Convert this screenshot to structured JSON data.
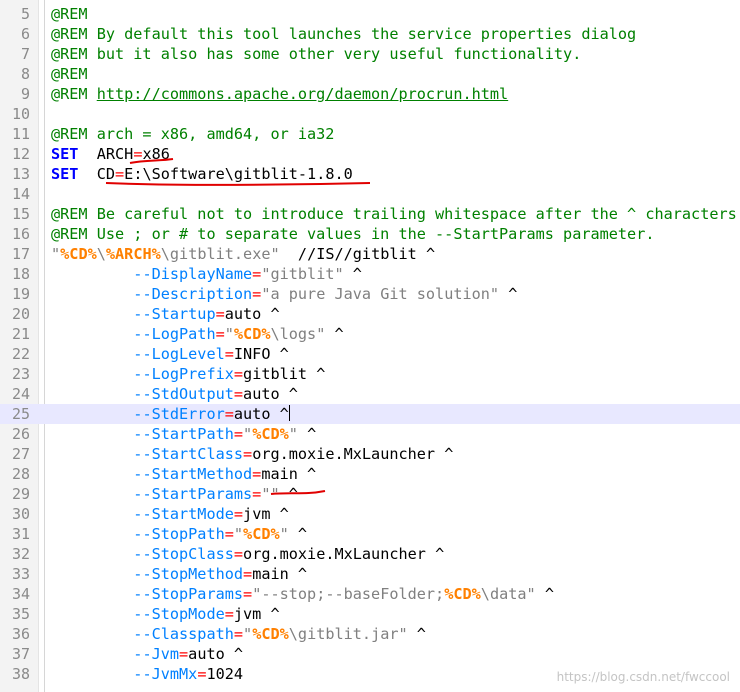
{
  "editor": {
    "lines": [
      {
        "n": "5",
        "segs": [
          [
            "cm",
            "@REM"
          ]
        ]
      },
      {
        "n": "6",
        "segs": [
          [
            "cm",
            "@REM By default this tool launches the service properties dialog"
          ]
        ]
      },
      {
        "n": "7",
        "segs": [
          [
            "cm",
            "@REM but it also has some other very useful functionality."
          ]
        ]
      },
      {
        "n": "8",
        "segs": [
          [
            "cm",
            "@REM"
          ]
        ]
      },
      {
        "n": "9",
        "segs": [
          [
            "cm",
            "@REM "
          ],
          [
            "cm url",
            "http://commons.apache.org/daemon/procrun.html"
          ]
        ]
      },
      {
        "n": "10",
        "segs": []
      },
      {
        "n": "11",
        "segs": [
          [
            "cm",
            "@REM arch = x86, amd64, or ia32"
          ]
        ]
      },
      {
        "n": "12",
        "segs": [
          [
            "kw",
            "SET"
          ],
          [
            "",
            "  ARCH"
          ],
          [
            "op",
            "="
          ],
          [
            "",
            "x86"
          ]
        ]
      },
      {
        "n": "13",
        "segs": [
          [
            "kw",
            "SET"
          ],
          [
            "",
            "  CD"
          ],
          [
            "op",
            "="
          ],
          [
            "",
            "E:\\Software\\gitblit-1.8.0"
          ]
        ]
      },
      {
        "n": "14",
        "segs": []
      },
      {
        "n": "15",
        "segs": [
          [
            "cm",
            "@REM Be careful not to introduce trailing whitespace after the ^ characters."
          ]
        ]
      },
      {
        "n": "16",
        "segs": [
          [
            "cm",
            "@REM Use ; or # to separate values in the --StartParams parameter."
          ]
        ]
      },
      {
        "n": "17",
        "segs": [
          [
            "str",
            "\""
          ],
          [
            "var",
            "%CD%"
          ],
          [
            "str",
            "\\"
          ],
          [
            "var",
            "%ARCH%"
          ],
          [
            "str",
            "\\gitblit.exe\""
          ],
          [
            "",
            "  //IS//gitblit ^"
          ]
        ]
      },
      {
        "n": "18",
        "segs": [
          [
            "",
            "         "
          ],
          [
            "lbl",
            "--DisplayName"
          ],
          [
            "op",
            "="
          ],
          [
            "str",
            "\"gitblit\""
          ],
          [
            "",
            " ^"
          ]
        ]
      },
      {
        "n": "19",
        "segs": [
          [
            "",
            "         "
          ],
          [
            "lbl",
            "--Description"
          ],
          [
            "op",
            "="
          ],
          [
            "str",
            "\"a pure Java Git solution\""
          ],
          [
            "",
            " ^"
          ]
        ]
      },
      {
        "n": "20",
        "segs": [
          [
            "",
            "         "
          ],
          [
            "lbl",
            "--Startup"
          ],
          [
            "op",
            "="
          ],
          [
            "",
            "auto ^"
          ]
        ]
      },
      {
        "n": "21",
        "segs": [
          [
            "",
            "         "
          ],
          [
            "lbl",
            "--LogPath"
          ],
          [
            "op",
            "="
          ],
          [
            "str",
            "\""
          ],
          [
            "var",
            "%CD%"
          ],
          [
            "str",
            "\\logs\""
          ],
          [
            "",
            " ^"
          ]
        ]
      },
      {
        "n": "22",
        "segs": [
          [
            "",
            "         "
          ],
          [
            "lbl",
            "--LogLevel"
          ],
          [
            "op",
            "="
          ],
          [
            "",
            "INFO ^"
          ]
        ]
      },
      {
        "n": "23",
        "segs": [
          [
            "",
            "         "
          ],
          [
            "lbl",
            "--LogPrefix"
          ],
          [
            "op",
            "="
          ],
          [
            "",
            "gitblit ^"
          ]
        ]
      },
      {
        "n": "24",
        "segs": [
          [
            "",
            "         "
          ],
          [
            "lbl",
            "--StdOutput"
          ],
          [
            "op",
            "="
          ],
          [
            "",
            "auto ^"
          ]
        ]
      },
      {
        "n": "25",
        "segs": [
          [
            "",
            "         "
          ],
          [
            "lbl",
            "--StdError"
          ],
          [
            "op",
            "="
          ],
          [
            "",
            "auto ^"
          ]
        ],
        "current": true
      },
      {
        "n": "26",
        "segs": [
          [
            "",
            "         "
          ],
          [
            "lbl",
            "--StartPath"
          ],
          [
            "op",
            "="
          ],
          [
            "str",
            "\""
          ],
          [
            "var",
            "%CD%"
          ],
          [
            "str",
            "\""
          ],
          [
            "",
            " ^"
          ]
        ]
      },
      {
        "n": "27",
        "segs": [
          [
            "",
            "         "
          ],
          [
            "lbl",
            "--StartClass"
          ],
          [
            "op",
            "="
          ],
          [
            "",
            "org.moxie.MxLauncher ^"
          ]
        ]
      },
      {
        "n": "28",
        "segs": [
          [
            "",
            "         "
          ],
          [
            "lbl",
            "--StartMethod"
          ],
          [
            "op",
            "="
          ],
          [
            "",
            "main ^"
          ]
        ]
      },
      {
        "n": "29",
        "segs": [
          [
            "",
            "         "
          ],
          [
            "lbl",
            "--StartParams"
          ],
          [
            "op",
            "="
          ],
          [
            "str",
            "\"\""
          ],
          [
            "",
            " ^"
          ]
        ]
      },
      {
        "n": "30",
        "segs": [
          [
            "",
            "         "
          ],
          [
            "lbl",
            "--StartMode"
          ],
          [
            "op",
            "="
          ],
          [
            "",
            "jvm ^"
          ]
        ]
      },
      {
        "n": "31",
        "segs": [
          [
            "",
            "         "
          ],
          [
            "lbl",
            "--StopPath"
          ],
          [
            "op",
            "="
          ],
          [
            "str",
            "\""
          ],
          [
            "var",
            "%CD%"
          ],
          [
            "str",
            "\""
          ],
          [
            "",
            " ^"
          ]
        ]
      },
      {
        "n": "32",
        "segs": [
          [
            "",
            "         "
          ],
          [
            "lbl",
            "--StopClass"
          ],
          [
            "op",
            "="
          ],
          [
            "",
            "org.moxie.MxLauncher ^"
          ]
        ]
      },
      {
        "n": "33",
        "segs": [
          [
            "",
            "         "
          ],
          [
            "lbl",
            "--StopMethod"
          ],
          [
            "op",
            "="
          ],
          [
            "",
            "main ^"
          ]
        ]
      },
      {
        "n": "34",
        "segs": [
          [
            "",
            "         "
          ],
          [
            "lbl",
            "--StopParams"
          ],
          [
            "op",
            "="
          ],
          [
            "str",
            "\"--stop;--baseFolder;"
          ],
          [
            "var",
            "%CD%"
          ],
          [
            "str",
            "\\data\""
          ],
          [
            "",
            " ^"
          ]
        ]
      },
      {
        "n": "35",
        "segs": [
          [
            "",
            "         "
          ],
          [
            "lbl",
            "--StopMode"
          ],
          [
            "op",
            "="
          ],
          [
            "",
            "jvm ^"
          ]
        ]
      },
      {
        "n": "36",
        "segs": [
          [
            "",
            "         "
          ],
          [
            "lbl",
            "--Classpath"
          ],
          [
            "op",
            "="
          ],
          [
            "str",
            "\""
          ],
          [
            "var",
            "%CD%"
          ],
          [
            "str",
            "\\gitblit.jar\""
          ],
          [
            "",
            " ^"
          ]
        ]
      },
      {
        "n": "37",
        "segs": [
          [
            "",
            "         "
          ],
          [
            "lbl",
            "--Jvm"
          ],
          [
            "op",
            "="
          ],
          [
            "",
            "auto ^"
          ]
        ]
      },
      {
        "n": "38",
        "segs": [
          [
            "",
            "         "
          ],
          [
            "lbl",
            "--JvmMx"
          ],
          [
            "op",
            "="
          ],
          [
            "",
            "1024"
          ]
        ]
      }
    ],
    "annotation_color": "#e00000"
  },
  "watermark": "https://blog.csdn.net/fwccool"
}
